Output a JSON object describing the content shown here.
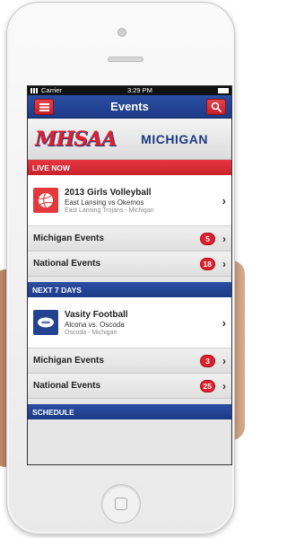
{
  "status_bar": {
    "carrier": "Carrier",
    "time": "3:29 PM"
  },
  "nav": {
    "title": "Events",
    "menu_icon": "menu-icon",
    "search_icon": "search-icon"
  },
  "banner": {
    "logo": "MHSAA",
    "state": "MICHIGAN"
  },
  "live_now": {
    "header": "LIVE NOW",
    "event": {
      "title": "2013 Girls Volleyball",
      "matchup": "East Lansing vs Okemos",
      "location": "East Lansing Trojans - Michigan",
      "icon": "volleyball-icon"
    },
    "rows": [
      {
        "label": "Michigan Events",
        "count": "5"
      },
      {
        "label": "National Events",
        "count": "18"
      }
    ]
  },
  "next_7_days": {
    "header": "NEXT 7 DAYS",
    "event": {
      "title": "Vasity Football",
      "matchup": "Alcona vs. Oscoda",
      "location": "Oscoda - Michigan",
      "icon": "football-icon"
    },
    "rows": [
      {
        "label": "Michigan Events",
        "count": "3"
      },
      {
        "label": "National Events",
        "count": "25"
      }
    ]
  },
  "schedule": {
    "header": "SCHEDULE"
  },
  "colors": {
    "brand_blue": "#1c3a86",
    "brand_red": "#e01f2b"
  }
}
